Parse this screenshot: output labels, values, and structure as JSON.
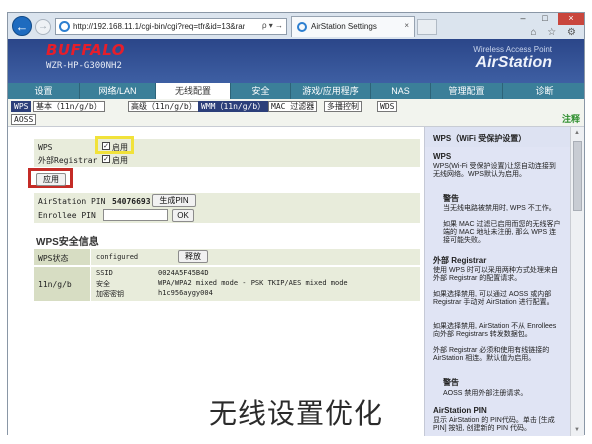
{
  "browser": {
    "url": "http://192.168.11.1/cgi-bin/cgi?req=tfr&id=13&rand=",
    "addr_controls": "ρ ▾ →",
    "tab_title": "AirStation Settings",
    "tab_close": "×",
    "back_icon": "←",
    "fwd_icon": "→",
    "win_min": "–",
    "win_max": "□",
    "win_close": "×",
    "tools_icons": "⌂ ☆ ⚙"
  },
  "router": {
    "logo": "BUFFALO",
    "model": "WZR-HP-G300NH2",
    "brand_sub": "Wireless Access Point",
    "brand": "AirStation",
    "main_nav": [
      "设置",
      "网络/LAN",
      "无线配置",
      "安全",
      "游戏/应用程序",
      "NAS",
      "管理配置",
      "诊断"
    ],
    "sub_nav": [
      "WPS",
      "基本（11n/g/b）",
      "高级（11n/g/b）",
      "WMM（11n/g/b）",
      "MAC 过滤器",
      "多播控制",
      "WDS",
      "AOSS"
    ],
    "sub_note": "注释"
  },
  "form": {
    "wps_label": "WPS",
    "wps_check_label": "启用",
    "ext_reg_label": "外部Registrar",
    "ext_reg_check_label": "启用",
    "apply": "应用",
    "pin_label": "AirStation PIN",
    "pin_value": "54076693",
    "gen_pin": "生成PIN",
    "enrollee_label": "Enrollee PIN",
    "ok": "OK",
    "info_title": "WPS安全信息",
    "state_label": "WPS状态",
    "state_value": "configured",
    "release": "释放",
    "band": "11n/g/b",
    "ssid_label": "SSID",
    "ssid_value": "0024A5F45B4D",
    "security_label": "安全",
    "security_value": "WPA/WPA2 mixed mode - PSK TKIP/AES mixed mode",
    "key_label": "加密密钥",
    "key_value": "h1c956aygy004"
  },
  "help": {
    "header": "WPS（WiFi 受保护设置）",
    "p1_title": "WPS",
    "p1_text": "WPS(Wi-Fi 受保护设置)让您自动连接到无线网络。WPS默认为启用。",
    "warn_title": "警告",
    "warn1": "当无线电路被禁用时, WPS 不工作。",
    "warn2": "如果 MAC 过滤已启用而您的无线客户端的 MAC 地址未注册, 那么 WPS 连接可能失败。",
    "p2_title": "外部 Registrar",
    "p2_text": "使用 WPS 时可以采用两种方式处理来自外部 Registrar 的配置请求。",
    "p2_text2": "如果选择禁用, 可以通过 AOSS 或内部 Registrar 手动对 AirStation 进行配置。",
    "p2_text3": "如果选择禁用, AirStation 不从 Enrollees 向外部 Registrars 转发数据包。",
    "p2_text4": "外部 Registrar 必须和使用有线链接的 AirStation 相连。默认值为启用。",
    "warn2_title": "警告",
    "warn3": "AOSS 禁用外部注册请求。",
    "p3_title": "AirStation PIN",
    "p3_text": "显示 AirStation 的 PIN代码。单击 [生成PIN] 按钮, 创建新的 PIN 代码。"
  },
  "caption": "无线设置优化"
}
